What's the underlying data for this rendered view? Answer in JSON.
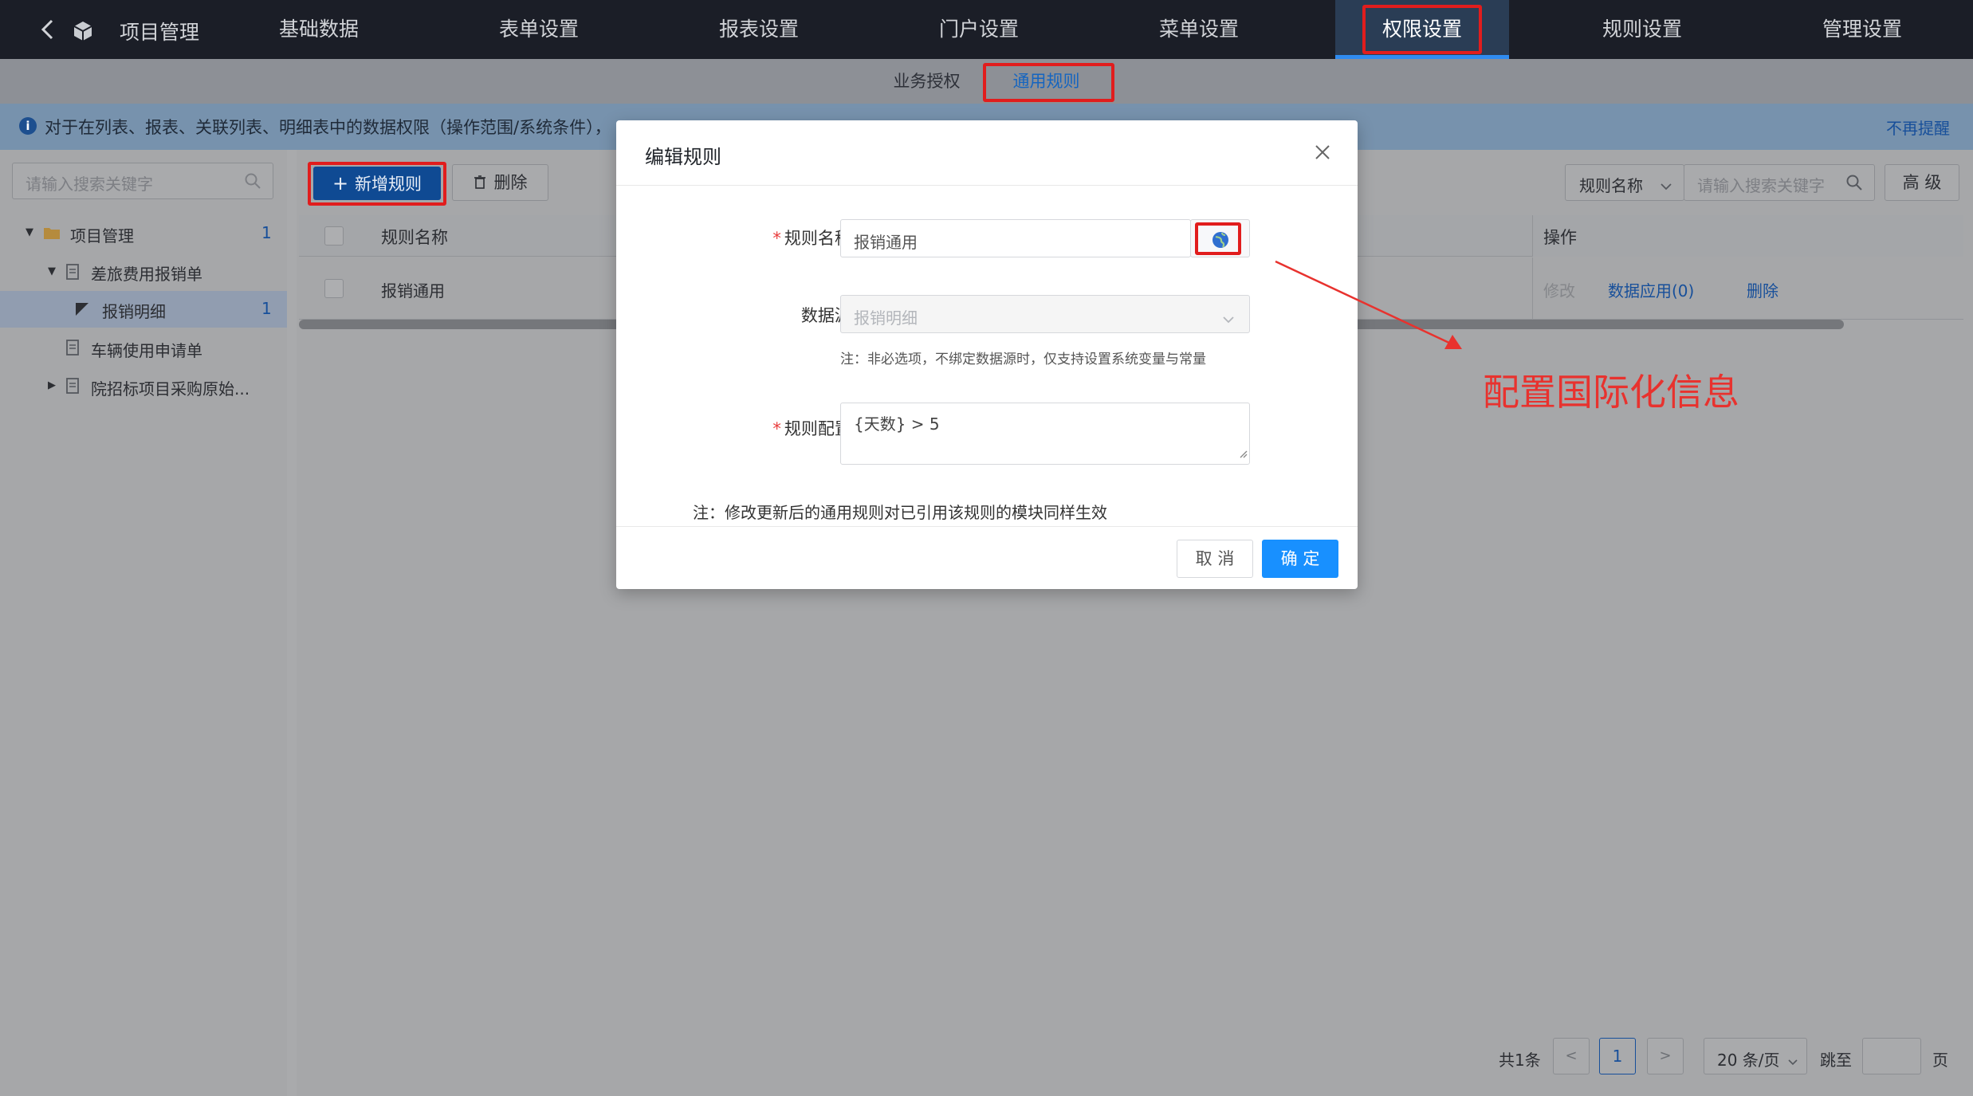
{
  "topnav": {
    "app_title": "项目管理",
    "tabs": [
      {
        "label": "基础数据"
      },
      {
        "label": "表单设置"
      },
      {
        "label": "报表设置"
      },
      {
        "label": "门户设置"
      },
      {
        "label": "菜单设置"
      },
      {
        "label": "权限设置"
      },
      {
        "label": "规则设置"
      },
      {
        "label": "管理设置"
      }
    ]
  },
  "subtabs": [
    {
      "label": "业务授权"
    },
    {
      "label": "通用规则"
    }
  ],
  "info": {
    "text": "对于在列表、报表、关联列表、明细表中的数据权限（操作范围/系统条件），",
    "dismiss": "不再提醒"
  },
  "sidebar": {
    "search_placeholder": "请输入搜索关键字",
    "tree": [
      {
        "label": "项目管理",
        "count": "1"
      },
      {
        "label": "差旅费用报销单"
      },
      {
        "label": "报销明细",
        "count": "1"
      },
      {
        "label": "车辆使用申请单"
      },
      {
        "label": "院招标项目采购原始..."
      }
    ]
  },
  "toolbar": {
    "add_label": "新增规则",
    "delete_label": "删除",
    "filter_field": "规则名称",
    "search_placeholder": "请输入搜索关键字",
    "advanced_label": "高 级"
  },
  "table": {
    "columns": [
      "规则名称",
      "操作"
    ],
    "rows": [
      {
        "name": "报销通用",
        "actions": [
          "修改",
          "数据应用(0)",
          "删除"
        ]
      }
    ]
  },
  "pagination": {
    "total": "共1条",
    "current_page": "1",
    "page_size": "20 条/页",
    "jump_label": "跳至",
    "page_suffix": "页"
  },
  "modal": {
    "title": "编辑规则",
    "name_label": "规则名称:",
    "name_value": "报销通用",
    "datasource_label": "数据源:",
    "datasource_value": "报销明细",
    "datasource_note": "注：非必选项，不绑定数据源时，仅支持设置系统变量与常量",
    "config_label": "规则配置:",
    "config_value": "{天数} > 5",
    "bottom_note": "注：修改更新后的通用规则对已引用该规则的模块同样生效",
    "cancel_label": "取 消",
    "ok_label": "确 定"
  },
  "annotation": {
    "text": "配置国际化信息",
    "color": "#e8322e"
  },
  "colors": {
    "accent": "#1890ff",
    "highlight": "#e11d1d",
    "nav_bg": "#1b1e27"
  }
}
